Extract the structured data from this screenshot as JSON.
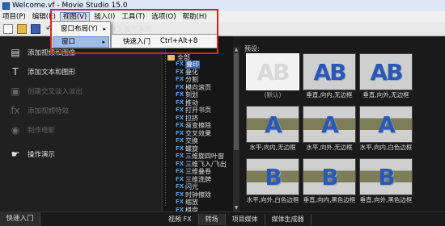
{
  "title_bar": {
    "title": "Welcome.vf - Movie Studio 15.0"
  },
  "menu": [
    "项目(P)",
    "编辑(E)",
    "视图(V)",
    "插入(I)",
    "工具(T)",
    "选项(O)",
    "帮助(H)"
  ],
  "view_menu": {
    "items": [
      {
        "label": "窗口布局(Y)",
        "arrow": "▸"
      },
      {
        "label": "窗口",
        "arrow": "▸"
      }
    ],
    "submenu": {
      "label": "快速入门",
      "shortcut": "Ctrl+Alt+8"
    }
  },
  "floating": {
    "op_demo": "操作演示"
  },
  "left_panel": {
    "items": [
      {
        "label": "添加视频和图像"
      },
      {
        "label": "添加文本和图形"
      },
      {
        "label": "创建交叉淡入淡出"
      },
      {
        "label": "添加视频特效"
      },
      {
        "label": "制作电影"
      },
      {
        "label": "操作演示"
      }
    ],
    "tab": "快速入门"
  },
  "tree": {
    "root": "全部",
    "nodes": [
      "叠印",
      "叠化",
      "分割",
      "模向滚页",
      "刻划",
      "推动",
      "打开书页",
      "拉挤",
      "渐变擦除",
      "交叉效果",
      "交换",
      "螺旋",
      "三维旋四叶窗",
      "三维飞入/飞出",
      "三维叠卷",
      "三维洗牌",
      "闪光",
      "时钟擦除",
      "缩放",
      "棋盘"
    ]
  },
  "preview": {
    "title": "预设:",
    "thumbs": [
      {
        "glyph": "AB",
        "label": "(默认)"
      },
      {
        "glyph": "AB",
        "label": "垂直,向内,无边框"
      },
      {
        "glyph": "AB",
        "label": "垂直,向外,无边框"
      },
      {
        "glyph": "A",
        "label": "水平,向内,无边框"
      },
      {
        "glyph": "A",
        "label": "水平,向外,无边框"
      },
      {
        "glyph": "A",
        "label": "水平,向内,白色边框"
      },
      {
        "glyph": "B",
        "label": "水平,向外,白色边框"
      },
      {
        "glyph": "B",
        "label": "垂直,向内,黑色边框"
      },
      {
        "glyph": "B",
        "label": "垂直,向外,黑色边框"
      }
    ]
  },
  "bottom_tabs": [
    "视频 FX",
    "转场",
    "项目媒体",
    "媒体生成器"
  ]
}
